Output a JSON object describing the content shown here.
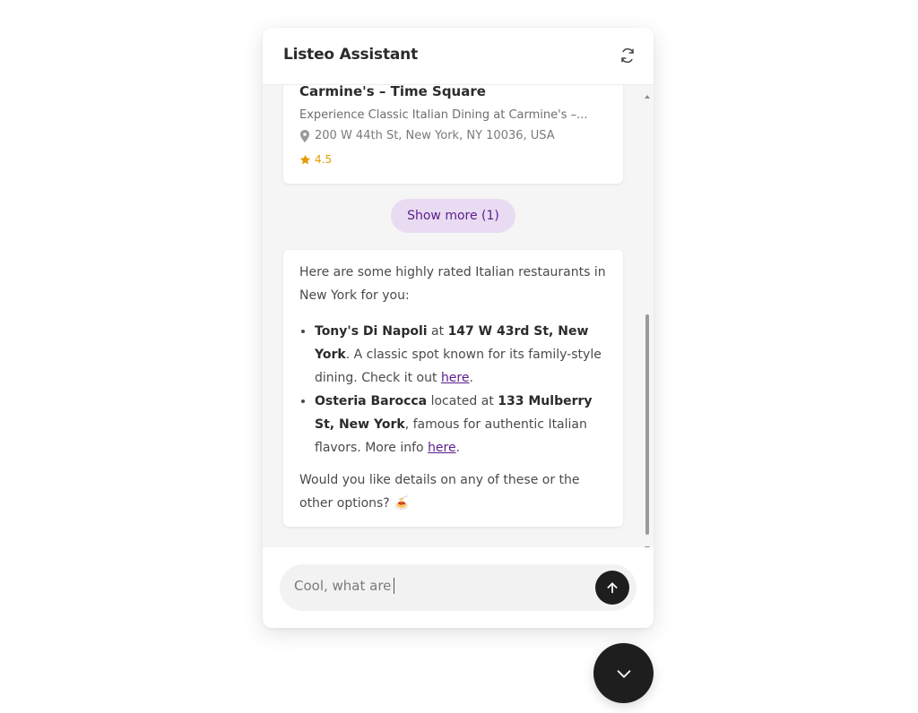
{
  "header": {
    "title": "Listeo Assistant",
    "refresh_icon": "refresh-icon"
  },
  "listing": {
    "title": "Carmine's – Time Square",
    "description": "Experience Classic Italian Dining at Carmine's –...",
    "address": "200 W 44th St, New York, NY 10036, USA",
    "rating": "4.5",
    "rating_color": "#e39b00"
  },
  "show_more": {
    "label": "Show more (1)"
  },
  "answer": {
    "intro": "Here are some highly rated Italian restaurants in New York for you:",
    "items": [
      {
        "name": "Tony's Di Napoli",
        "connector": " at ",
        "address": "147 W 43rd St, New York",
        "after_address": ". A classic spot known for its family-style dining. Check it out ",
        "link_text": "here",
        "end": "."
      },
      {
        "name": "Osteria Barocca",
        "connector": " located at ",
        "address": "133 Mulberry St, New York",
        "after_address": ", famous for authentic Italian flavors. More info ",
        "link_text": "here",
        "end": "."
      }
    ],
    "outro": "Would you like details on any of these or the other options? 🍝"
  },
  "composer": {
    "input_value": "Cool, what are",
    "send_icon": "arrow-up-icon"
  },
  "fab": {
    "icon": "chevron-down-icon"
  },
  "colors": {
    "accent": "#5a1e8c",
    "accent_bg": "#e9dcf2",
    "dark": "#1e1e1e",
    "panel_bg": "#f5f5f5"
  }
}
